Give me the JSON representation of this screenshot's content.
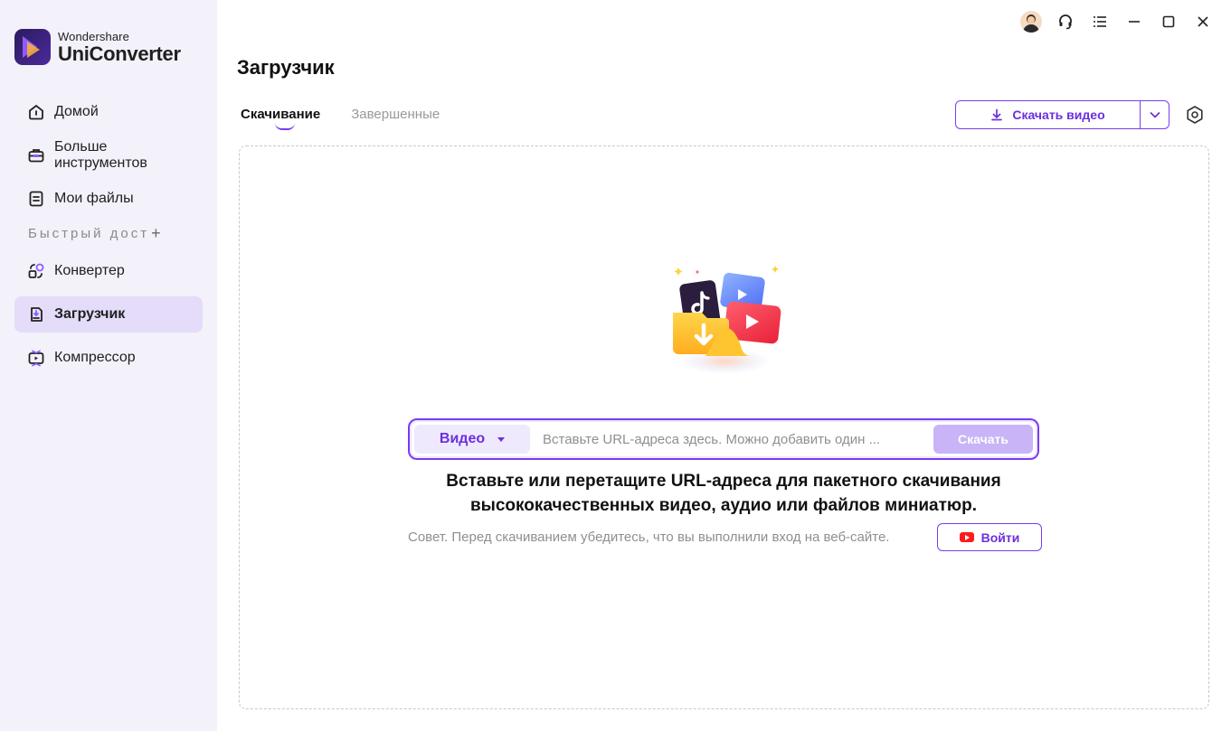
{
  "app": {
    "brand": "Wondershare",
    "product": "UniConverter"
  },
  "sidebar": {
    "top_items": [
      {
        "label": "Домой",
        "icon": "home-icon"
      },
      {
        "label": "Больше инструментов",
        "icon": "toolbox-icon"
      },
      {
        "label": "Мои файлы",
        "icon": "file-icon"
      }
    ],
    "quick_access_label": "Быстрый дост",
    "quick_access_add": "+",
    "bottom_items": [
      {
        "label": "Конвертер",
        "icon": "converter-icon"
      },
      {
        "label": "Загрузчик",
        "icon": "downloader-icon",
        "active": true
      },
      {
        "label": "Компрессор",
        "icon": "compressor-icon"
      }
    ]
  },
  "titlebar": {
    "icons": [
      "avatar-icon",
      "headset-icon",
      "menu-icon",
      "minimize-icon",
      "maximize-icon",
      "close-icon"
    ]
  },
  "main": {
    "title": "Загрузчик",
    "tabs": [
      {
        "label": "Скачивание",
        "active": true
      },
      {
        "label": "Завершенные",
        "active": false
      }
    ],
    "download_button": "Скачать видео",
    "url_bar": {
      "type_selected": "Видео",
      "placeholder": "Вставьте URL-адреса здесь. Можно добавить один ...",
      "download_label": "Скачать"
    },
    "headline_line1": "Вставьте или перетащите URL-адреса для пакетного скачивания",
    "headline_line2": "высококачественных видео, аудио или файлов миниатюр.",
    "tip": "Совет. Перед скачиванием убедитесь, что вы выполнили вход на веб-сайте.",
    "login_button": "Войти"
  },
  "colors": {
    "accent": "#7a3cf0",
    "sidebar_bg": "#f3f1fa",
    "active_nav_bg": "#e4dcf8",
    "download_btn_disabled": "#c8b4f6"
  }
}
